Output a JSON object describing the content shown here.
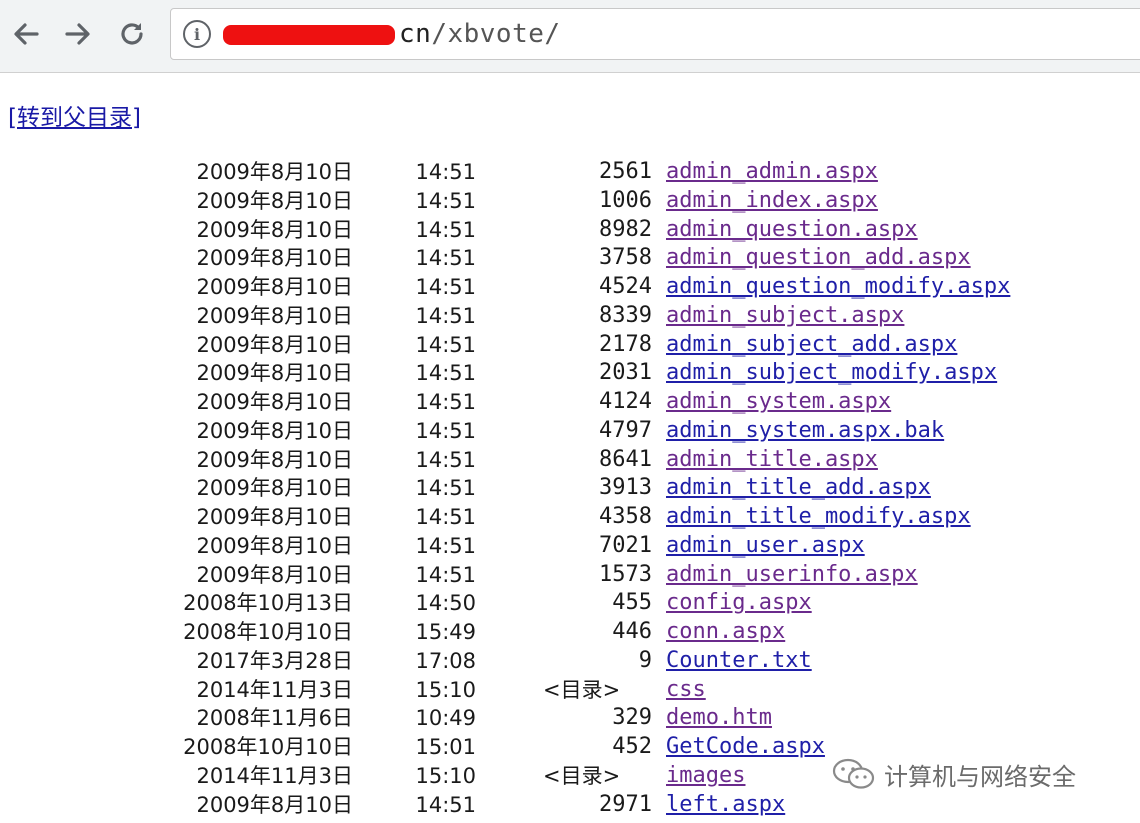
{
  "browser": {
    "url_host_suffix": "cn",
    "url_path": "/xbvote/",
    "icons": {
      "back": "arrow-left",
      "forward": "arrow-right",
      "reload": "refresh",
      "site_info": "info-circle"
    }
  },
  "page": {
    "parent_link": "[转到父目录]",
    "dir_tag": "<目录>",
    "entries": [
      {
        "date": "2009年8月10日",
        "time": "14:51",
        "size": "2561",
        "name": "admin_admin.aspx",
        "is_dir": false,
        "visited": true
      },
      {
        "date": "2009年8月10日",
        "time": "14:51",
        "size": "1006",
        "name": "admin_index.aspx",
        "is_dir": false,
        "visited": true
      },
      {
        "date": "2009年8月10日",
        "time": "14:51",
        "size": "8982",
        "name": "admin_question.aspx",
        "is_dir": false,
        "visited": true
      },
      {
        "date": "2009年8月10日",
        "time": "14:51",
        "size": "3758",
        "name": "admin_question_add.aspx",
        "is_dir": false,
        "visited": true
      },
      {
        "date": "2009年8月10日",
        "time": "14:51",
        "size": "4524",
        "name": "admin_question_modify.aspx",
        "is_dir": false,
        "visited": false
      },
      {
        "date": "2009年8月10日",
        "time": "14:51",
        "size": "8339",
        "name": "admin_subject.aspx",
        "is_dir": false,
        "visited": true
      },
      {
        "date": "2009年8月10日",
        "time": "14:51",
        "size": "2178",
        "name": "admin_subject_add.aspx",
        "is_dir": false,
        "visited": false
      },
      {
        "date": "2009年8月10日",
        "time": "14:51",
        "size": "2031",
        "name": "admin_subject_modify.aspx",
        "is_dir": false,
        "visited": false
      },
      {
        "date": "2009年8月10日",
        "time": "14:51",
        "size": "4124",
        "name": "admin_system.aspx",
        "is_dir": false,
        "visited": true
      },
      {
        "date": "2009年8月10日",
        "time": "14:51",
        "size": "4797",
        "name": "admin_system.aspx.bak",
        "is_dir": false,
        "visited": false
      },
      {
        "date": "2009年8月10日",
        "time": "14:51",
        "size": "8641",
        "name": "admin_title.aspx",
        "is_dir": false,
        "visited": true
      },
      {
        "date": "2009年8月10日",
        "time": "14:51",
        "size": "3913",
        "name": "admin_title_add.aspx",
        "is_dir": false,
        "visited": false
      },
      {
        "date": "2009年8月10日",
        "time": "14:51",
        "size": "4358",
        "name": "admin_title_modify.aspx",
        "is_dir": false,
        "visited": false
      },
      {
        "date": "2009年8月10日",
        "time": "14:51",
        "size": "7021",
        "name": "admin_user.aspx",
        "is_dir": false,
        "visited": false
      },
      {
        "date": "2009年8月10日",
        "time": "14:51",
        "size": "1573",
        "name": "admin_userinfo.aspx",
        "is_dir": false,
        "visited": true
      },
      {
        "date": "2008年10月13日",
        "time": "14:50",
        "size": "455",
        "name": "config.aspx",
        "is_dir": false,
        "visited": true
      },
      {
        "date": "2008年10月10日",
        "time": "15:49",
        "size": "446",
        "name": "conn.aspx",
        "is_dir": false,
        "visited": true
      },
      {
        "date": "2017年3月28日",
        "time": "17:08",
        "size": "9",
        "name": "Counter.txt",
        "is_dir": false,
        "visited": false
      },
      {
        "date": "2014年11月3日",
        "time": "15:10",
        "size": "",
        "name": "css",
        "is_dir": true,
        "visited": true
      },
      {
        "date": "2008年11月6日",
        "time": "10:49",
        "size": "329",
        "name": "demo.htm",
        "is_dir": false,
        "visited": true
      },
      {
        "date": "2008年10月10日",
        "time": "15:01",
        "size": "452",
        "name": "GetCode.aspx",
        "is_dir": false,
        "visited": false
      },
      {
        "date": "2014年11月3日",
        "time": "15:10",
        "size": "",
        "name": "images",
        "is_dir": true,
        "visited": true
      },
      {
        "date": "2009年8月10日",
        "time": "14:51",
        "size": "2971",
        "name": "left.aspx",
        "is_dir": false,
        "visited": false
      }
    ]
  },
  "watermark": {
    "text": "计算机与网络安全",
    "icon": "wechat-logo"
  }
}
